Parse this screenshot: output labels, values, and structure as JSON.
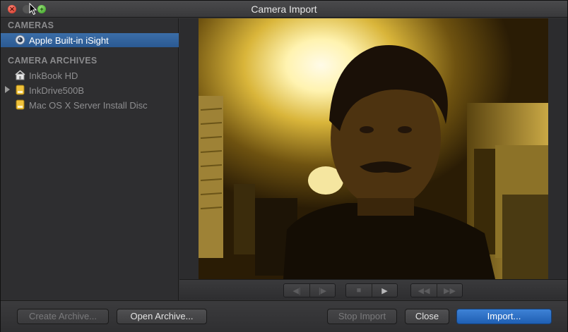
{
  "window": {
    "title": "Camera Import"
  },
  "sidebar": {
    "cameras_heading": "CAMERAS",
    "cameras": [
      {
        "label": "Apple Built-in iSight",
        "icon": "webcam-icon",
        "selected": true
      }
    ],
    "archives_heading": "CAMERA ARCHIVES",
    "archives": [
      {
        "label": "InkBook HD",
        "icon": "home-drive-icon"
      },
      {
        "label": "InkDrive500B",
        "icon": "external-drive-icon",
        "expandable": true
      },
      {
        "label": "Mac OS X Server Install Disc",
        "icon": "disc-icon"
      }
    ]
  },
  "colors": {
    "accent": "#2b5a92",
    "primary_button": "#2f72c9",
    "panel": "#2e2e30"
  },
  "footer": {
    "create_archive": "Create Archive...",
    "open_archive": "Open Archive...",
    "stop_import": "Stop Import",
    "close": "Close",
    "import": "Import..."
  }
}
